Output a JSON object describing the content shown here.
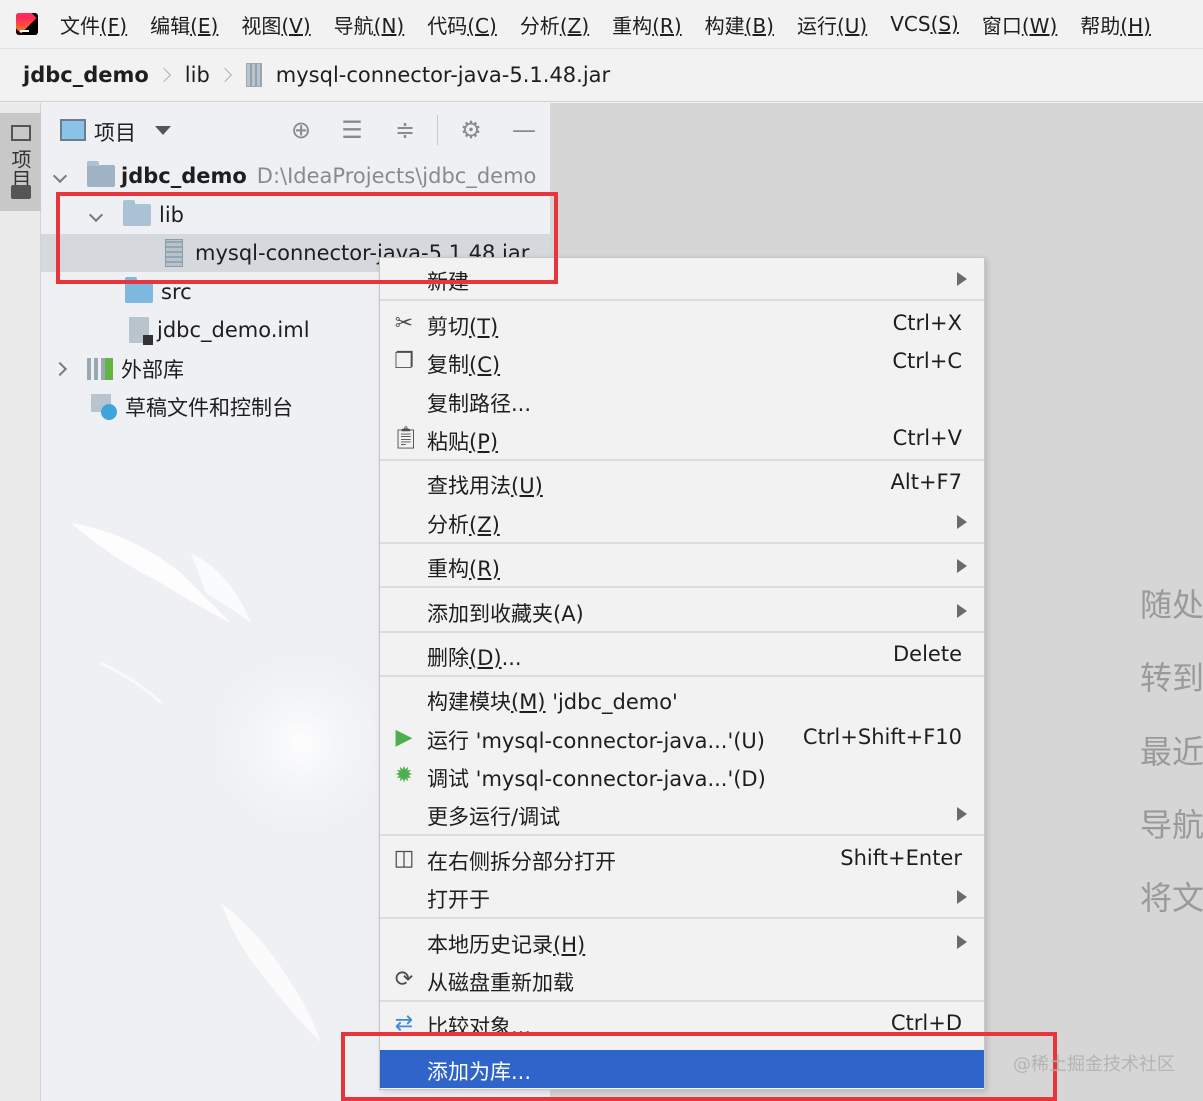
{
  "menubar": {
    "items": [
      {
        "label": "文件",
        "mnemonic": "(F)"
      },
      {
        "label": "编辑",
        "mnemonic": "(E)"
      },
      {
        "label": "视图",
        "mnemonic": "(V)"
      },
      {
        "label": "导航",
        "mnemonic": "(N)"
      },
      {
        "label": "代码",
        "mnemonic": "(C)"
      },
      {
        "label": "分析",
        "mnemonic": "(Z)"
      },
      {
        "label": "重构",
        "mnemonic": "(R)"
      },
      {
        "label": "构建",
        "mnemonic": "(B)"
      },
      {
        "label": "运行",
        "mnemonic": "(U)"
      },
      {
        "label": "VCS",
        "mnemonic": "(S)"
      },
      {
        "label": "窗口",
        "mnemonic": "(W)"
      },
      {
        "label": "帮助",
        "mnemonic": "(H)"
      }
    ]
  },
  "breadcrumb": {
    "project": "jdbc_demo",
    "folder": "lib",
    "file": "mysql-connector-java-5.1.48.jar"
  },
  "toolstrip": {
    "tab_label": "项目"
  },
  "project_panel": {
    "title": "项目",
    "tree": {
      "root": {
        "name": "jdbc_demo",
        "path": "D:\\IdeaProjects\\jdbc_demo"
      },
      "lib": "lib",
      "jar": "mysql-connector-java-5.1.48.jar",
      "src": "src",
      "iml": "jdbc_demo.iml",
      "external_libs": "外部库",
      "scratches": "草稿文件和控制台"
    }
  },
  "context_menu": {
    "new": "新建",
    "cut": {
      "label": "剪切",
      "mn": "(T)",
      "shortcut": "Ctrl+X"
    },
    "copy": {
      "label": "复制",
      "mn": "(C)",
      "shortcut": "Ctrl+C"
    },
    "copy_path": "复制路径...",
    "paste": {
      "label": "粘贴",
      "mn": "(P)",
      "shortcut": "Ctrl+V"
    },
    "find_usages": {
      "label": "查找用法",
      "mn": "(U)",
      "shortcut": "Alt+F7"
    },
    "analyze": {
      "label": "分析",
      "mn": "(Z)"
    },
    "refactor": {
      "label": "重构",
      "mn": "(R)"
    },
    "add_favorites": "添加到收藏夹(A)",
    "delete": {
      "label": "删除",
      "mn": "(D)",
      "suffix": "...",
      "shortcut": "Delete"
    },
    "build_module": {
      "label": "构建模块",
      "mn": "(M)",
      "suffix": " 'jdbc_demo'"
    },
    "run": {
      "label": "运行 'mysql-connector-java...'(U)",
      "shortcut": "Ctrl+Shift+F10"
    },
    "debug": "调试 'mysql-connector-java...'(D)",
    "more_run": "更多运行/调试",
    "split_open": {
      "label": "在右侧拆分部分打开",
      "shortcut": "Shift+Enter"
    },
    "open_in": "打开于",
    "local_history": {
      "label": "本地历史记录",
      "mn": "(H)"
    },
    "reload": "从磁盘重新加载",
    "compare": {
      "label": "比较对象...",
      "shortcut": "Ctrl+D"
    },
    "add_as_library": "添加为库..."
  },
  "editor_hints": [
    "随处",
    "转到",
    "最近",
    "导航",
    "将文"
  ],
  "watermark": "@稀土掘金技术社区",
  "colors": {
    "highlight_red": "#e8343b",
    "selection_blue": "#2f65ca",
    "run_green": "#4cae4c"
  }
}
